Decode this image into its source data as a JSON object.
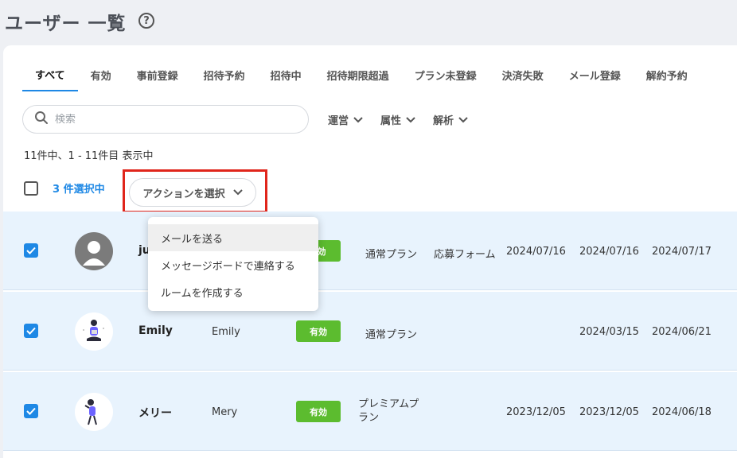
{
  "page": {
    "title": "ユーザー 一覧",
    "help_glyph": "?"
  },
  "tabs": [
    {
      "label": "すべて"
    },
    {
      "label": "有効"
    },
    {
      "label": "事前登録"
    },
    {
      "label": "招待予約"
    },
    {
      "label": "招待中"
    },
    {
      "label": "招待期限超過"
    },
    {
      "label": "プラン未登録"
    },
    {
      "label": "決済失敗"
    },
    {
      "label": "メール登録"
    },
    {
      "label": "解約予約"
    }
  ],
  "search": {
    "placeholder": "検索",
    "value": ""
  },
  "filters": [
    {
      "label": "運営"
    },
    {
      "label": "属性"
    },
    {
      "label": "解析"
    }
  ],
  "result_count": "11件中、1 - 11件目 表示中",
  "selection": {
    "label": "3 件選択中"
  },
  "action_select": {
    "label": "アクションを選択"
  },
  "dropdown": {
    "items": [
      {
        "label": "メールを送る"
      },
      {
        "label": "メッセージボードで連絡する"
      },
      {
        "label": "ルームを作成する"
      }
    ]
  },
  "rows": [
    {
      "checked": true,
      "name": "ju",
      "plan": "通常プラン",
      "source": "応募フォーム",
      "date1": "2024/07/16",
      "date2": "2024/07/16",
      "date3": "2024/07/17",
      "status": "効"
    },
    {
      "checked": true,
      "name": "Emily",
      "nickname": "Emily",
      "status": "有効",
      "plan": "通常プラン",
      "date2": "2024/03/15",
      "date3": "2024/06/21"
    },
    {
      "checked": true,
      "name": "メリー",
      "nickname": "Mery",
      "status": "有効",
      "plan": "プレミアムプラン",
      "date1": "2023/12/05",
      "date2": "2023/12/05",
      "date3": "2024/06/18"
    }
  ],
  "colors": {
    "accent": "#1e88e5",
    "badge": "#5cbc2f",
    "highlight": "#e0251b",
    "row_selected": "#e8f3fd"
  }
}
